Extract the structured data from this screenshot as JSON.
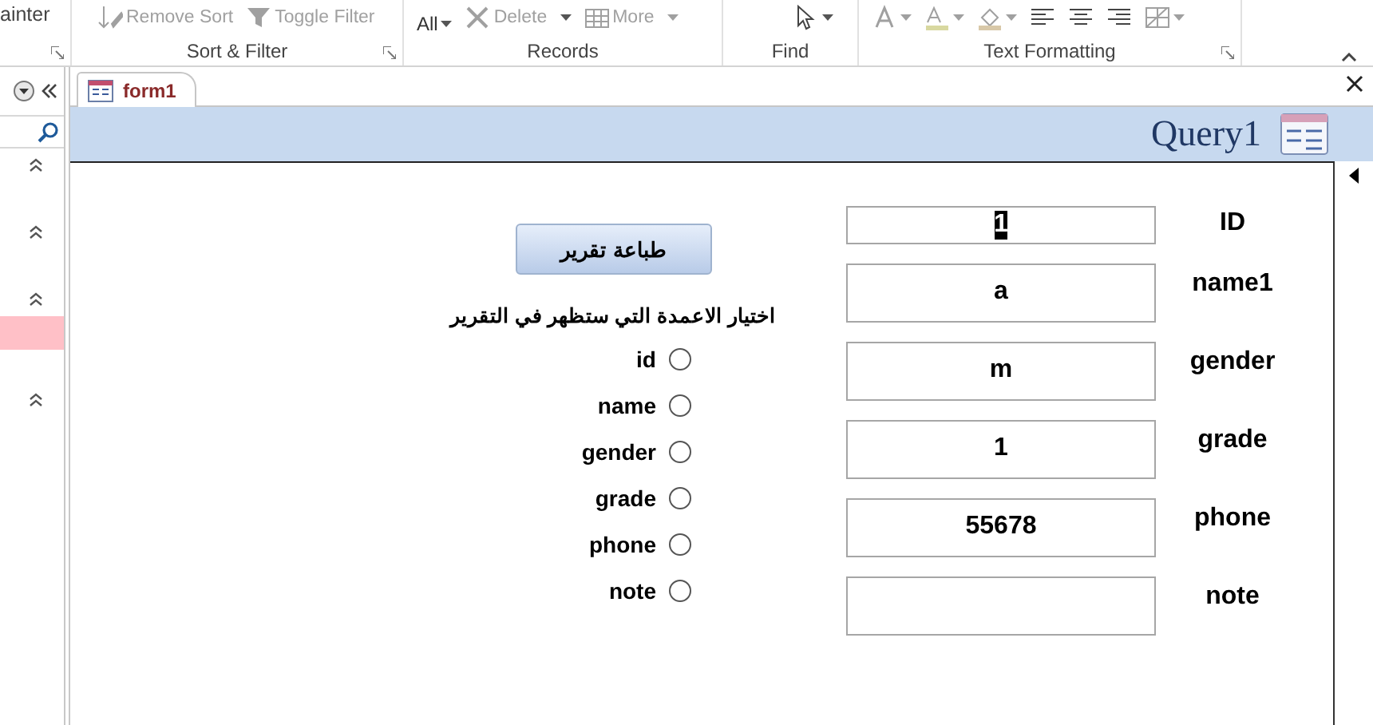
{
  "ribbon": {
    "partial_label": "ainter",
    "groups": [
      {
        "label": "Sort & Filter",
        "commands": [
          {
            "kind": "spacer"
          },
          {
            "kind": "small",
            "label": "Remove Sort",
            "disabled": true
          },
          {
            "kind": "small",
            "label": "Toggle Filter",
            "disabled": true
          }
        ]
      },
      {
        "label": "Records",
        "commands": [
          {
            "kind": "refresh",
            "label": "All",
            "disabled": false
          },
          {
            "kind": "small",
            "label": "Delete",
            "disabled": true
          },
          {
            "kind": "small",
            "label": "More",
            "disabled": true
          }
        ]
      },
      {
        "label": "Find",
        "commands": [
          {
            "kind": "spacer"
          },
          {
            "kind": "iconbutton",
            "disabled": false
          }
        ]
      },
      {
        "label": "Text Formatting",
        "commands": [
          {
            "kind": "iconbutton",
            "disabled": true
          },
          {
            "kind": "iconbutton",
            "disabled": true
          },
          {
            "kind": "iconbutton",
            "disabled": true
          },
          {
            "kind": "iconbutton",
            "disabled": false
          },
          {
            "kind": "iconbutton",
            "disabled": false
          },
          {
            "kind": "iconbutton",
            "disabled": false
          },
          {
            "kind": "iconbutton",
            "disabled": true
          }
        ]
      }
    ]
  },
  "nav_pane": {
    "rows": [
      {
        "kind": "header"
      },
      {
        "kind": "header"
      },
      {
        "kind": "header"
      },
      {
        "kind": "item",
        "selected": true
      },
      {
        "kind": "header"
      }
    ]
  },
  "document_tab": {
    "label": "form1",
    "selected": true
  },
  "form": {
    "title": "Query1",
    "fields": [
      {
        "label": "ID",
        "value": "1",
        "highlighted": true
      },
      {
        "label": "name1",
        "value": "a",
        "highlighted": false
      },
      {
        "label": "gender",
        "value": "m",
        "highlighted": false
      },
      {
        "label": "grade",
        "value": "1",
        "highlighted": false
      },
      {
        "label": "phone",
        "value": "55678",
        "highlighted": false
      },
      {
        "label": "note",
        "highlighted": false
      }
    ],
    "print_button": "طباعة تقرير",
    "column_chooser": {
      "title": "اختيار الاعمدة التي ستظهر في التقرير",
      "options": [
        {
          "label": "id",
          "selected": false
        },
        {
          "label": "name",
          "selected": false
        },
        {
          "label": "gender",
          "selected": false
        },
        {
          "label": "grade",
          "selected": false
        },
        {
          "label": "phone",
          "selected": false
        },
        {
          "label": "note",
          "selected": false
        }
      ]
    }
  }
}
